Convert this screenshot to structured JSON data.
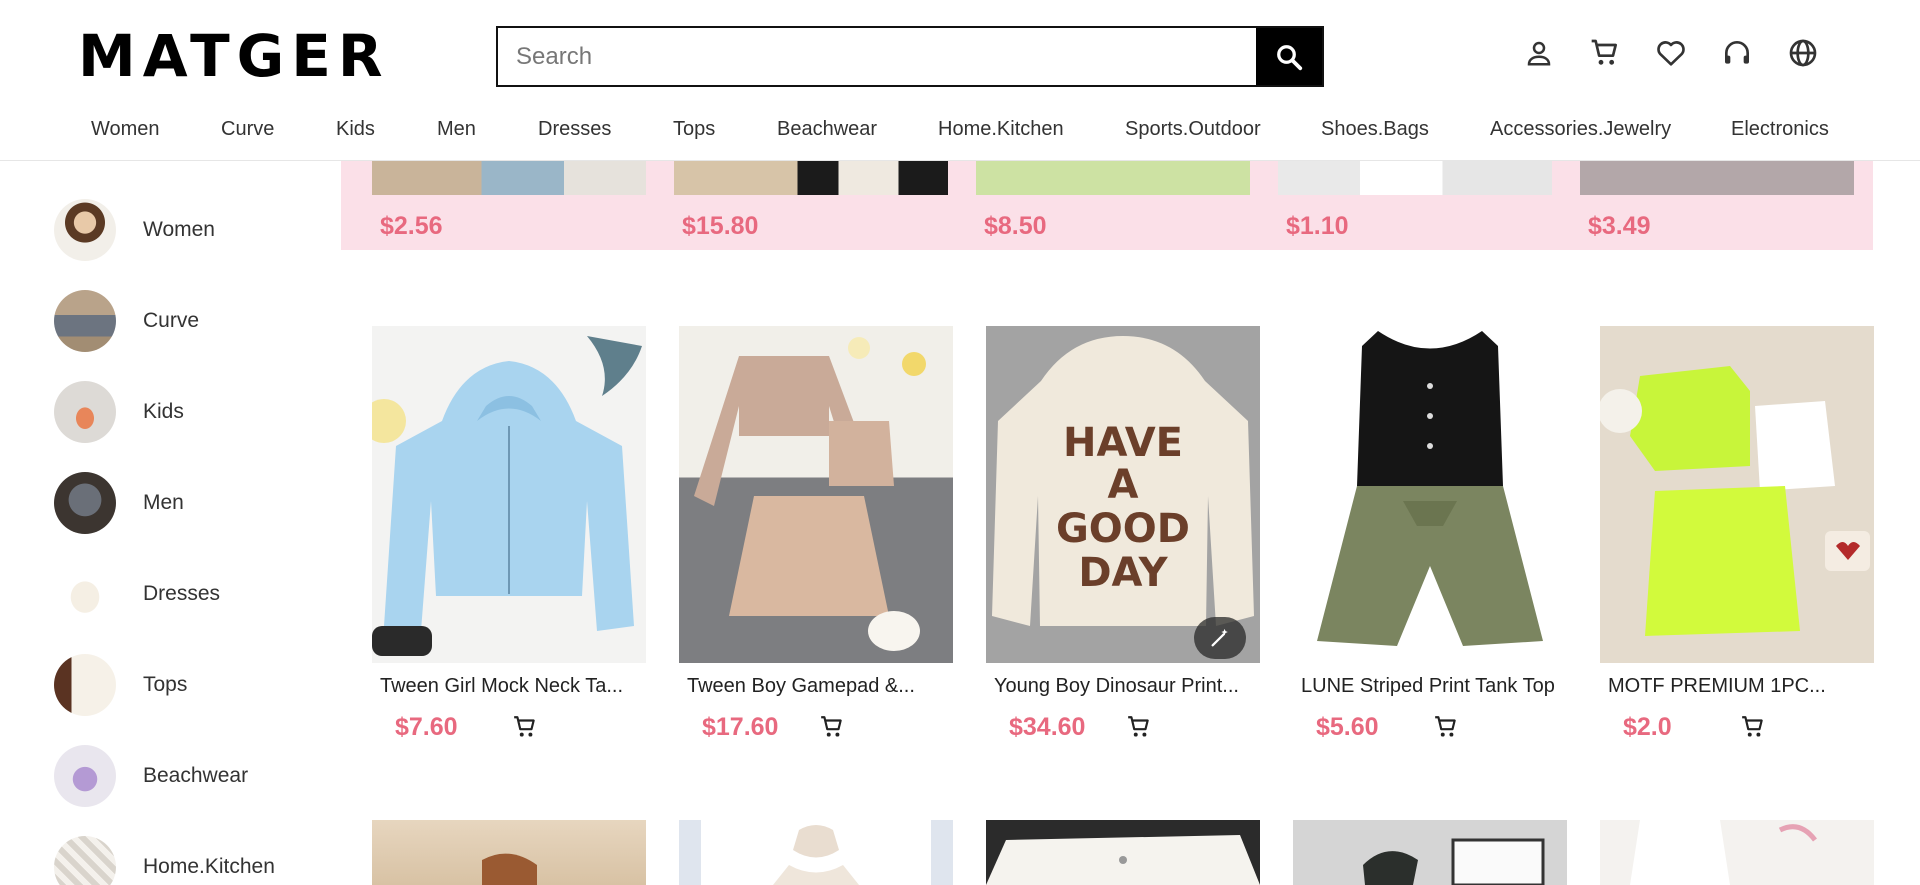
{
  "brand": {
    "logo": "MATGER"
  },
  "search": {
    "placeholder": "Search"
  },
  "header_icons": [
    "user-icon",
    "cart-icon",
    "heart-icon",
    "headset-icon",
    "globe-icon"
  ],
  "nav": [
    "Women",
    "Curve",
    "Kids",
    "Men",
    "Dresses",
    "Tops",
    "Beachwear",
    "Home.Kitchen",
    "Sports.Outdoor",
    "Shoes.Bags",
    "Accessories.Jewelry",
    "Electronics"
  ],
  "sidebar": [
    "Women",
    "Curve",
    "Kids",
    "Men",
    "Dresses",
    "Tops",
    "Beachwear",
    "Home.Kitchen"
  ],
  "promo": {
    "prices": [
      "$2.56",
      "$15.80",
      "$8.50",
      "$1.10",
      "$3.49"
    ]
  },
  "products": [
    {
      "title": "Tween Girl Mock Neck Ta...",
      "price": "$7.60"
    },
    {
      "title": "Tween Boy Gamepad &...",
      "price": "$17.60"
    },
    {
      "title": "Young Boy Dinosaur Print...",
      "price": "$34.60"
    },
    {
      "title": "LUNE Striped Print Tank Top",
      "price": "$5.60"
    },
    {
      "title": "MOTF PREMIUM 1PC...",
      "price": "$2.0"
    }
  ],
  "colors": {
    "price": "#e8697f",
    "promo_bg": "#fbe0e8",
    "accent": "#000000"
  }
}
